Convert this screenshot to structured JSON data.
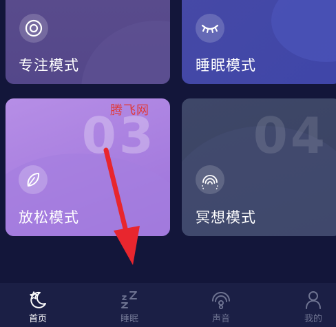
{
  "cards": [
    {
      "label": "专注模式",
      "number": "",
      "icon": "focus-target-icon"
    },
    {
      "label": "睡眠模式",
      "number": "",
      "icon": "closed-eye-icon"
    },
    {
      "label": "放松模式",
      "number": "03",
      "icon": "leaf-icon"
    },
    {
      "label": "冥想模式",
      "number": "04",
      "icon": "fingerprint-icon"
    }
  ],
  "watermark": "腾飞网",
  "annotation": {
    "icon": "red-arrow-annotation",
    "color": "#e8262e"
  },
  "tabbar": {
    "tabs": [
      {
        "label": "首页",
        "icon": "home-moon-icon",
        "active": true
      },
      {
        "label": "睡眠",
        "icon": "zzz-sleep-icon",
        "active": false
      },
      {
        "label": "声音",
        "icon": "sound-waves-icon",
        "active": false
      },
      {
        "label": "我的",
        "icon": "profile-icon",
        "active": false
      }
    ]
  },
  "colors": {
    "background": "#13163a",
    "tabbar": "#1b1f45",
    "active_tab": "#ffffff",
    "inactive_tab": "#6e7391"
  }
}
